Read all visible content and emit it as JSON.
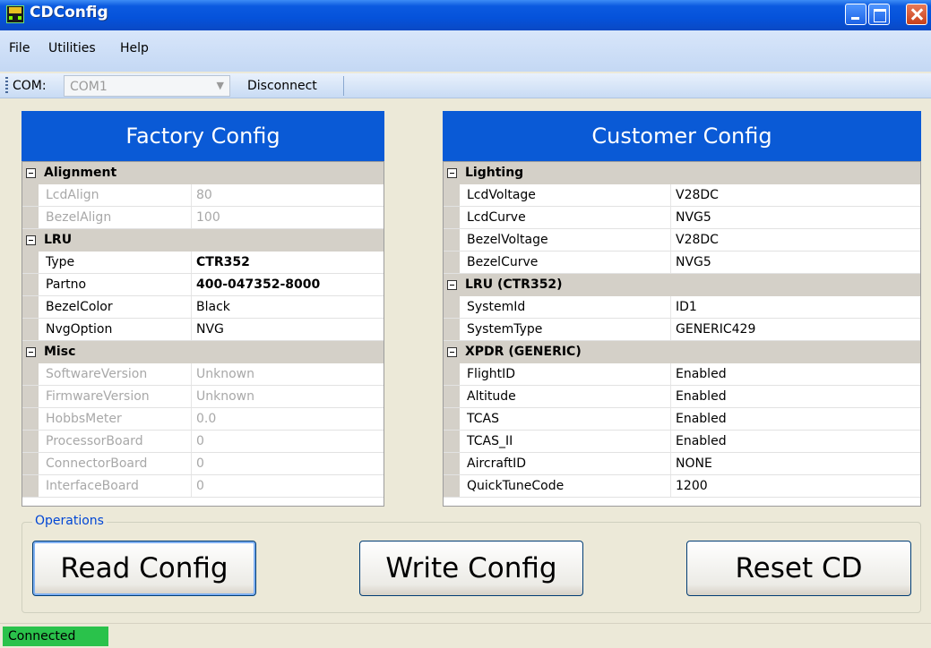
{
  "window": {
    "title": "CDConfig"
  },
  "menu": {
    "items": [
      "File",
      "Utilities",
      "Help"
    ]
  },
  "toolbar": {
    "com_label": "COM:",
    "com_value": "COM1",
    "disconnect_label": "Disconnect"
  },
  "factory": {
    "header": "Factory Config",
    "groups": [
      {
        "label": "Alignment",
        "rows": [
          {
            "name": "LcdAlign",
            "value": "80",
            "disabled": true
          },
          {
            "name": "BezelAlign",
            "value": "100",
            "disabled": true
          }
        ]
      },
      {
        "label": "LRU",
        "rows": [
          {
            "name": "Type",
            "value": "CTR352",
            "bold": true
          },
          {
            "name": "Partno",
            "value": "400-047352-8000",
            "bold": true
          },
          {
            "name": "BezelColor",
            "value": "Black"
          },
          {
            "name": "NvgOption",
            "value": "NVG"
          }
        ]
      },
      {
        "label": "Misc",
        "rows": [
          {
            "name": "SoftwareVersion",
            "value": "Unknown",
            "disabled": true
          },
          {
            "name": "FirmwareVersion",
            "value": "Unknown",
            "disabled": true
          },
          {
            "name": "HobbsMeter",
            "value": "0.0",
            "disabled": true
          },
          {
            "name": "ProcessorBoard",
            "value": "0",
            "disabled": true
          },
          {
            "name": "ConnectorBoard",
            "value": "0",
            "disabled": true
          },
          {
            "name": "InterfaceBoard",
            "value": "0",
            "disabled": true
          }
        ]
      }
    ]
  },
  "customer": {
    "header": "Customer Config",
    "groups": [
      {
        "label": "Lighting",
        "rows": [
          {
            "name": "LcdVoltage",
            "value": "V28DC"
          },
          {
            "name": "LcdCurve",
            "value": "NVG5"
          },
          {
            "name": "BezelVoltage",
            "value": "V28DC"
          },
          {
            "name": "BezelCurve",
            "value": "NVG5"
          }
        ]
      },
      {
        "label": "LRU (CTR352)",
        "rows": [
          {
            "name": "SystemId",
            "value": "ID1"
          },
          {
            "name": "SystemType",
            "value": "GENERIC429"
          }
        ]
      },
      {
        "label": "XPDR (GENERIC)",
        "rows": [
          {
            "name": "FlightID",
            "value": "Enabled"
          },
          {
            "name": "Altitude",
            "value": "Enabled"
          },
          {
            "name": "TCAS",
            "value": "Enabled"
          },
          {
            "name": "TCAS_II",
            "value": "Enabled"
          },
          {
            "name": "AircraftID",
            "value": "NONE"
          },
          {
            "name": "QuickTuneCode",
            "value": "1200"
          }
        ]
      }
    ]
  },
  "operations": {
    "label": "Operations",
    "read_label": "Read Config",
    "write_label": "Write Config",
    "reset_label": "Reset CD"
  },
  "status": {
    "text": "Connected"
  }
}
